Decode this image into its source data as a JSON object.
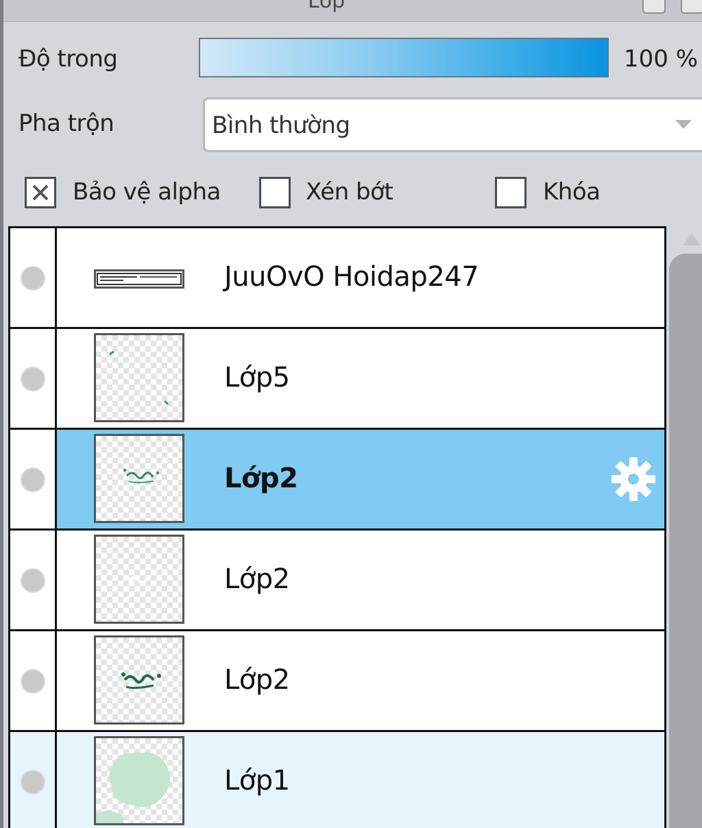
{
  "panel": {
    "title": "Lớp"
  },
  "opacity": {
    "label": "Độ trong",
    "value_text": "100 %",
    "value": 100
  },
  "blend": {
    "label": "Pha trộn",
    "selected": "Bình thường"
  },
  "options": {
    "protect_alpha": {
      "label": "Bảo vệ alpha",
      "checked": true
    },
    "clip": {
      "label": "Xén bớt",
      "checked": false
    },
    "lock": {
      "label": "Khóa",
      "checked": false
    }
  },
  "layers": [
    {
      "name": "JuuOvO Hoidap247",
      "state": "normal",
      "thumb": "text-layer"
    },
    {
      "name": "Lớp5",
      "state": "normal",
      "thumb": "sparse-marks"
    },
    {
      "name": "Lớp2",
      "state": "selected",
      "thumb": "green-sketch",
      "icon": "gear-icon"
    },
    {
      "name": "Lớp2",
      "state": "normal",
      "thumb": "white-sketch"
    },
    {
      "name": "Lớp2",
      "state": "normal",
      "thumb": "dark-green-sketch"
    },
    {
      "name": "Lớp1",
      "state": "light",
      "thumb": "mint-blob"
    }
  ],
  "colors": {
    "selected_row": "#7fcbf1",
    "light_row": "#e6f4fb",
    "panel_bg": "#d4d7db",
    "opacity_bar_end": "#0a93e0"
  }
}
